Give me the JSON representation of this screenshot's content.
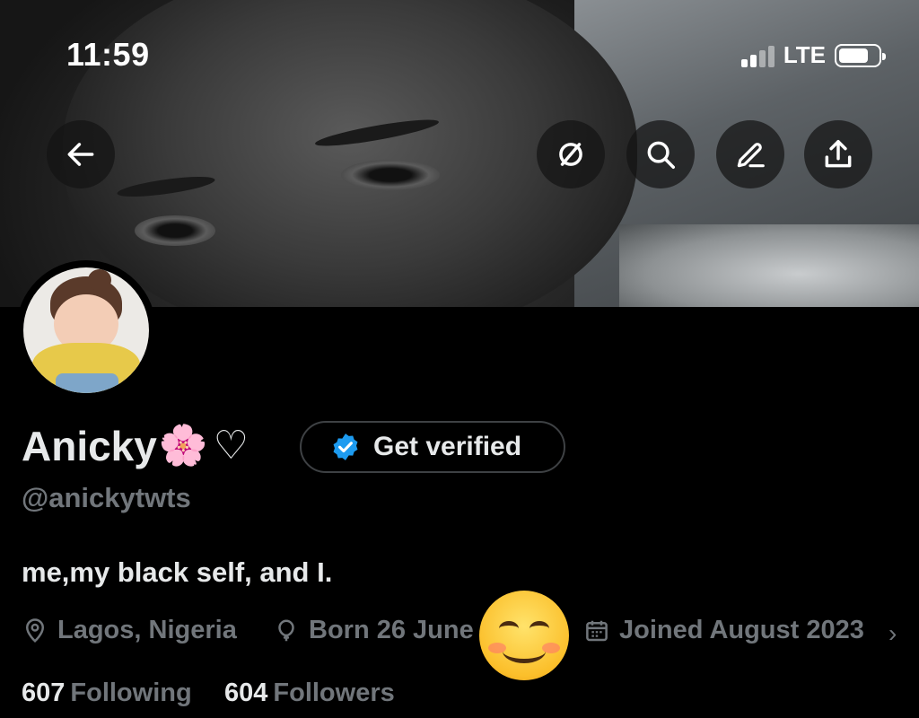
{
  "status_bar": {
    "time": "11:59",
    "network": "LTE"
  },
  "header": {
    "buttons": [
      {
        "icon": "back-arrow-icon"
      },
      {
        "icon": "grok-icon"
      },
      {
        "icon": "search-icon"
      },
      {
        "icon": "edit-icon"
      },
      {
        "icon": "share-icon"
      }
    ]
  },
  "profile": {
    "name": "Anicky",
    "name_emoji": "🌸",
    "name_symbol": "♡",
    "verify_button": "Get verified",
    "handle": "@anickytwts",
    "bio": "me,my black self, and I.",
    "location": "Lagos, Nigeria",
    "birthday": "Born 26 June",
    "joined": "Joined August 2023",
    "following_count": "607",
    "following_label": "Following",
    "followers_count": "604",
    "followers_label": "Followers"
  },
  "colors": {
    "background": "#000000",
    "text_primary": "#e7e9ea",
    "text_secondary": "#71767b",
    "verified_blue": "#1d9bf0"
  }
}
